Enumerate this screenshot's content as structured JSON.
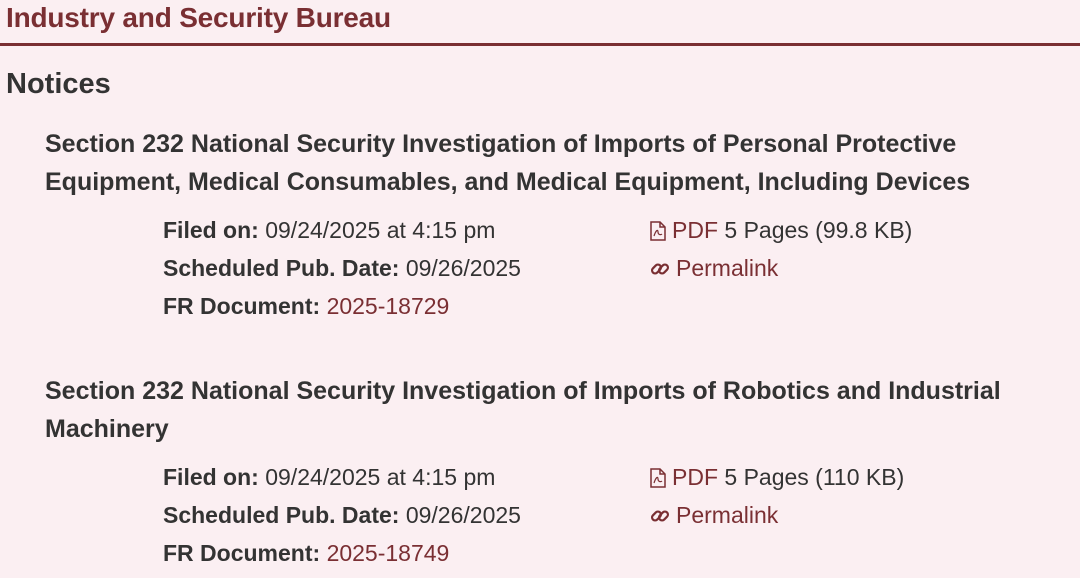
{
  "agency": {
    "title": "Industry and Security Bureau"
  },
  "section": {
    "heading": "Notices"
  },
  "documents": [
    {
      "title": "Section 232 National Security Investigation of Imports of Personal Protective Equipment, Medical Consumables, and Medical Equipment, Including Devices",
      "filed_label": "Filed on:",
      "filed_value": "09/24/2025 at 4:15 pm",
      "pub_label": "Scheduled Pub. Date:",
      "pub_value": "09/26/2025",
      "fr_label": "FR Document:",
      "fr_value": "2025-18729",
      "pdf_label": "PDF",
      "pdf_info": "5 Pages (99.8 KB)",
      "permalink_label": "Permalink"
    },
    {
      "title": "Section 232 National Security Investigation of Imports of Robotics and Industrial Machinery",
      "filed_label": "Filed on:",
      "filed_value": "09/24/2025 at 4:15 pm",
      "pub_label": "Scheduled Pub. Date:",
      "pub_value": "09/26/2025",
      "fr_label": "FR Document:",
      "fr_value": "2025-18749",
      "pdf_label": "PDF",
      "pdf_info": "5 Pages (110 KB)",
      "permalink_label": "Permalink"
    }
  ],
  "colors": {
    "accent": "#7a2f33",
    "background": "#fbeff2",
    "text": "#333333"
  },
  "icons": {
    "pdf": "pdf-file-icon",
    "permalink": "link-icon"
  }
}
